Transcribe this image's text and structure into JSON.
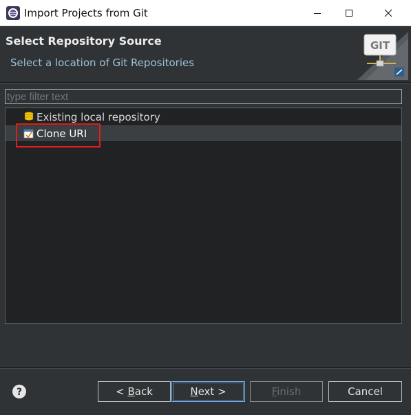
{
  "window": {
    "title": "Import Projects from Git"
  },
  "banner": {
    "title": "Select Repository Source",
    "subtitle": "Select a location of Git Repositories",
    "logo_text": "GIT"
  },
  "filter": {
    "placeholder": "type filter text",
    "value": ""
  },
  "tree": {
    "items": [
      {
        "label": "Existing local repository",
        "icon": "database-icon",
        "selected": false
      },
      {
        "label": "Clone URI",
        "icon": "clone-uri-icon",
        "selected": true
      }
    ]
  },
  "buttons": {
    "back": {
      "prefix": "< ",
      "mnemonic": "B",
      "rest": "ack"
    },
    "next": {
      "mnemonic": "N",
      "rest": "ext >"
    },
    "finish": {
      "mnemonic": "F",
      "rest": "inish"
    },
    "cancel": "Cancel"
  },
  "colors": {
    "highlight_box": "#e31c1c",
    "banner_subtitle": "#9ec0d6",
    "dialog_bg": "#2f3336"
  }
}
